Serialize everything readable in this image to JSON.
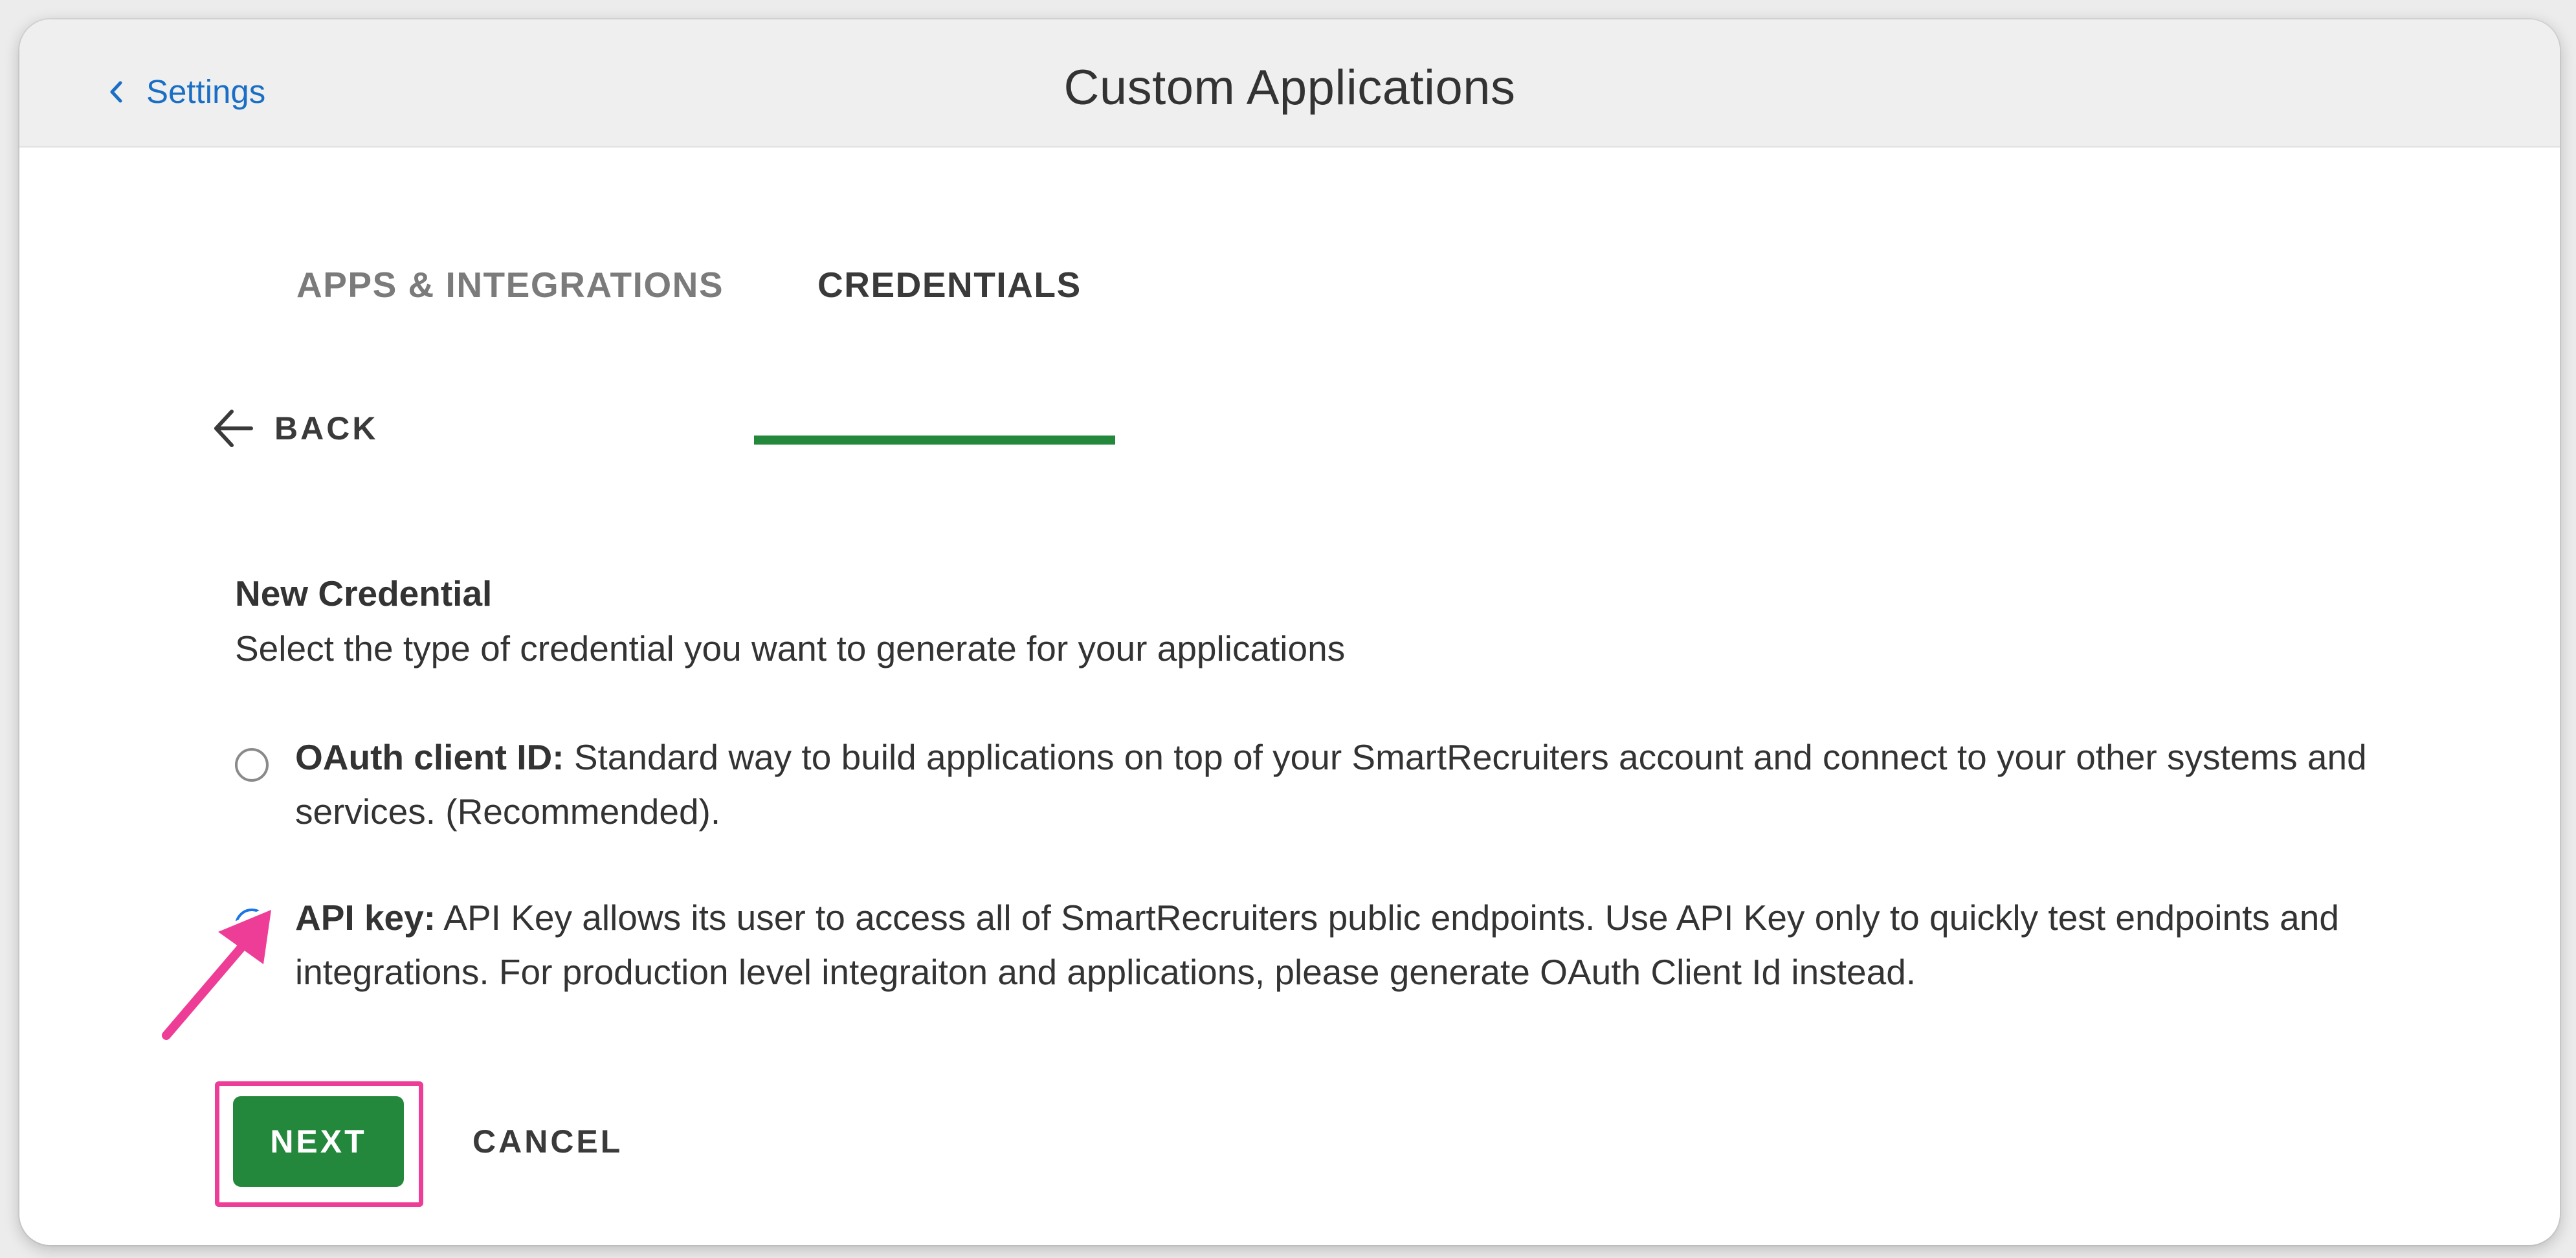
{
  "header": {
    "back_label": "Settings",
    "title": "Custom Applications"
  },
  "tabs": [
    {
      "label": "APPS & INTEGRATIONS",
      "active": false
    },
    {
      "label": "CREDENTIALS",
      "active": true
    }
  ],
  "back_link": {
    "label": "BACK",
    "icon": "arrow-left-icon"
  },
  "form": {
    "title": "New Credential",
    "description": "Select the type of credential you want to generate for your applications",
    "options": [
      {
        "name": "OAuth client ID:",
        "description": " Standard way to build applications on top of your SmartRecruiters account and connect to your other systems and services. (Recommended).",
        "selected": false
      },
      {
        "name": "API key:",
        "description": " API Key allows its user to access all of SmartRecruiters public endpoints. Use API Key only to quickly test endpoints and integrations. For production level integraiton and applications, please generate OAuth Client Id instead.",
        "selected": true
      }
    ]
  },
  "actions": {
    "next_label": "NEXT",
    "cancel_label": "CANCEL"
  },
  "colors": {
    "accent_green": "#23883c",
    "link_blue": "#1a6fc4",
    "radio_blue": "#1a73e8",
    "highlight_pink": "#ee3d96"
  }
}
